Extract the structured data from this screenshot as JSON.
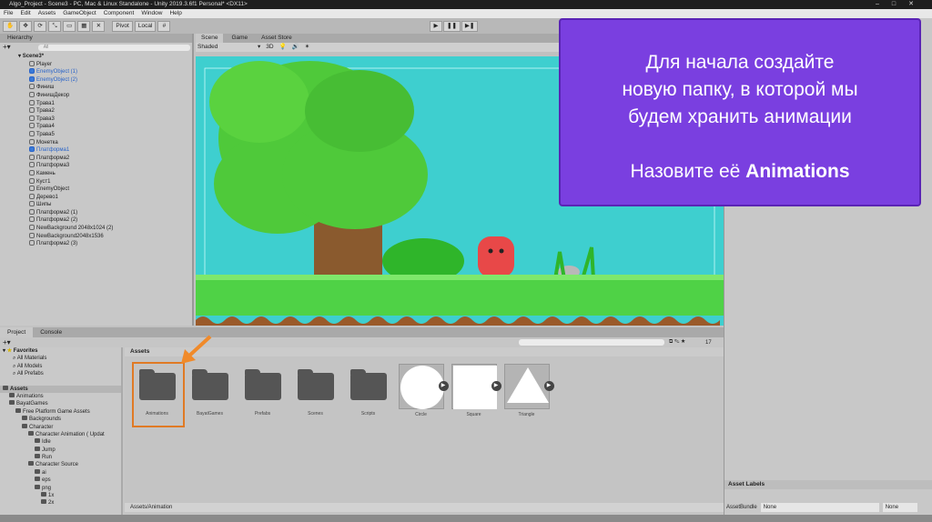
{
  "window": {
    "title": "Algo_Project - Scene3 - PC, Mac & Linux Standalone - Unity 2019.3.6f1 Personal* <DX11>"
  },
  "menu": [
    "File",
    "Edit",
    "Assets",
    "GameObject",
    "Component",
    "Window",
    "Help"
  ],
  "toolbar": {
    "pivot": "Pivot",
    "local": "Local",
    "play": "▶",
    "pause": "❚❚",
    "step": "▶❚"
  },
  "hierarchy": {
    "title": "Hierarchy",
    "search_placeholder": "All",
    "scene": "Scene3*",
    "items": [
      {
        "label": "Player",
        "blue": false
      },
      {
        "label": "EnemyObject (1)",
        "blue": true
      },
      {
        "label": "EnemyObject (2)",
        "blue": true
      },
      {
        "label": "Финиш",
        "blue": false
      },
      {
        "label": "ФинишДекор",
        "blue": false
      },
      {
        "label": "Трава1",
        "blue": false
      },
      {
        "label": "Трава2",
        "blue": false
      },
      {
        "label": "Трава3",
        "blue": false
      },
      {
        "label": "Трава4",
        "blue": false
      },
      {
        "label": "Трава5",
        "blue": false
      },
      {
        "label": "Монетка",
        "blue": false
      },
      {
        "label": "Платформа1",
        "blue": true
      },
      {
        "label": "Платформа2",
        "blue": false
      },
      {
        "label": "Платформа3",
        "blue": false
      },
      {
        "label": "Камень",
        "blue": false
      },
      {
        "label": "Куст1",
        "blue": false
      },
      {
        "label": "EnemyObject",
        "blue": false
      },
      {
        "label": "Дерево1",
        "blue": false
      },
      {
        "label": "Шипы",
        "blue": false
      },
      {
        "label": "Платформа2 (1)",
        "blue": false
      },
      {
        "label": "Платформа2 (2)",
        "blue": false
      },
      {
        "label": "NewBackground 2048x1024 (2)",
        "blue": false
      },
      {
        "label": "NewBackground2048x1536",
        "blue": false
      },
      {
        "label": "Платформа2 (3)",
        "blue": false
      }
    ]
  },
  "scene": {
    "tabs": [
      "Scene",
      "Game",
      "Asset Store"
    ],
    "shading": "Shaded",
    "mode2d": "3D"
  },
  "callout": {
    "line1": "Для начала создайте",
    "line2": "новую папку, в которой мы",
    "line3": "будем хранить анимации",
    "line4_prefix": "Назовите её ",
    "line4_bold": "Animations"
  },
  "project": {
    "tabs": [
      "Project",
      "Console"
    ],
    "favorites": {
      "title": "Favorites",
      "items": [
        "All Materials",
        "All Models",
        "All Prefabs"
      ]
    },
    "tree": [
      {
        "label": "Assets",
        "d": 0
      },
      {
        "label": "Animations",
        "d": 1
      },
      {
        "label": "BayatGames",
        "d": 1
      },
      {
        "label": "Free Platform Game Assets",
        "d": 2
      },
      {
        "label": "Backgrounds",
        "d": 3
      },
      {
        "label": "Character",
        "d": 3
      },
      {
        "label": "Character Animation ( Updat",
        "d": 4
      },
      {
        "label": "Idle",
        "d": 5
      },
      {
        "label": "Jump",
        "d": 5
      },
      {
        "label": "Run",
        "d": 5
      },
      {
        "label": "Character Source",
        "d": 4
      },
      {
        "label": "ai",
        "d": 5
      },
      {
        "label": "eps",
        "d": 5
      },
      {
        "label": "png",
        "d": 5
      },
      {
        "label": "1x",
        "d": 6
      },
      {
        "label": "2x",
        "d": 6
      }
    ],
    "breadcrumb": "Assets",
    "count": "17",
    "assets": [
      {
        "label": "Animations",
        "kind": "folder"
      },
      {
        "label": "BayatGames",
        "kind": "folder"
      },
      {
        "label": "Prefabs",
        "kind": "folder"
      },
      {
        "label": "Scenes",
        "kind": "folder"
      },
      {
        "label": "Scripts",
        "kind": "folder"
      },
      {
        "label": "Circle",
        "kind": "circle"
      },
      {
        "label": "Square",
        "kind": "square"
      },
      {
        "label": "Triangle",
        "kind": "triangle"
      }
    ],
    "path": "Assets/Animation"
  },
  "inspector": {
    "asset_labels": "Asset Labels",
    "asset_bundle": "AssetBundle",
    "bundle_value": "None",
    "variant_value": "None"
  },
  "colors": {
    "accent": "#7a3fe0",
    "highlight": "#e07a25",
    "sky": "#3ecfcf"
  }
}
